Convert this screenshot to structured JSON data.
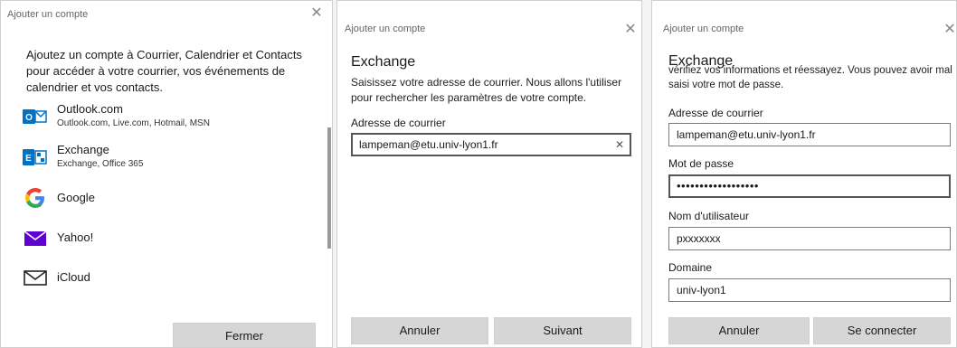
{
  "panel1": {
    "title": "Ajouter un compte",
    "close": "✕",
    "intro": "Ajoutez un compte à Courrier, Calendrier et Contacts pour accéder à votre courrier, vos événements de calendrier et vos contacts.",
    "accounts": [
      {
        "name": "Outlook.com",
        "sub": "Outlook.com, Live.com, Hotmail, MSN",
        "icon": "outlook-icon"
      },
      {
        "name": "Exchange",
        "sub": "Exchange, Office 365",
        "icon": "exchange-icon"
      },
      {
        "name": "Google",
        "sub": "",
        "icon": "google-icon"
      },
      {
        "name": "Yahoo!",
        "sub": "",
        "icon": "yahoo-icon"
      },
      {
        "name": "iCloud",
        "sub": "",
        "icon": "mail-envelope-icon"
      }
    ],
    "close_button": "Fermer"
  },
  "panel2": {
    "title": "Ajouter un compte",
    "close": "✕",
    "heading": "Exchange",
    "description": "Saisissez votre adresse de courrier. Nous allons l'utiliser pour rechercher les paramètres de votre compte.",
    "email_label": "Adresse de courrier",
    "email_value": "lampeman@etu.univ-lyon1.fr",
    "clear": "✕",
    "cancel_button": "Annuler",
    "next_button": "Suivant"
  },
  "panel3": {
    "title": "Ajouter un compte",
    "close": "✕",
    "heading": "Exchange",
    "description": "vérifiez vos informations et réessayez. Vous pouvez avoir mal saisi votre mot de passe.",
    "email_label": "Adresse de courrier",
    "email_value": "lampeman@etu.univ-lyon1.fr",
    "password_label": "Mot de passe",
    "password_value": "••••••••••••••••••",
    "username_label": "Nom d'utilisateur",
    "username_value": "pxxxxxxx",
    "domain_label": "Domaine",
    "domain_value": "univ-lyon1",
    "cancel_button": "Annuler",
    "connect_button": "Se connecter"
  },
  "colors": {
    "outlook_blue": "#0072c6",
    "exchange_blue": "#0072c6",
    "yahoo_purple": "#5f01d1",
    "button_gray": "#d6d6d6"
  }
}
